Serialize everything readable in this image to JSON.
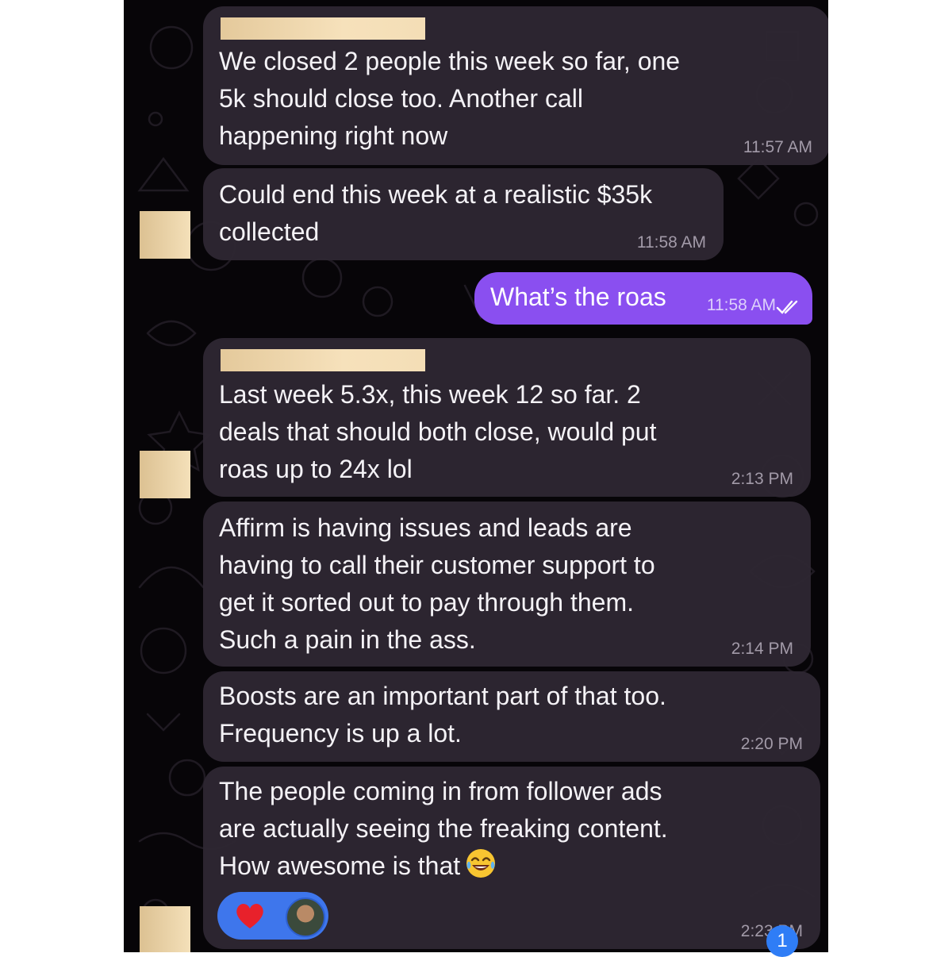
{
  "messages": [
    {
      "direction": "incoming",
      "sender_name": "",
      "text": "We closed 2 people this week so far, one\n5k should close too. Another call\nhappening right now",
      "time": "11:57 AM"
    },
    {
      "direction": "incoming",
      "text": "Could end this week at a realistic $35k\ncollected",
      "time": "11:58 AM"
    },
    {
      "direction": "outgoing",
      "text": "What’s the roas",
      "time": "11:58 AM",
      "status_icon": "double-check-icon"
    },
    {
      "direction": "incoming",
      "sender_name": "",
      "text": "Last week 5.3x, this week 12 so far. 2\ndeals that should both close, would put\nroas up to 24x lol",
      "time": "2:13 PM"
    },
    {
      "direction": "incoming",
      "text": "Affirm is having issues and leads are\nhaving to call their customer support to\nget it sorted out to pay through them.\nSuch a pain in the ass.",
      "time": "2:14 PM"
    },
    {
      "direction": "incoming",
      "text": "Boosts are an important part of that too.\nFrequency is up a lot.",
      "time": "2:20 PM"
    },
    {
      "direction": "incoming",
      "text": "The people coming in from follower ads\nare actually seeing the freaking content.\nHow awesome is that",
      "emoji": "laughing-tears-emoji",
      "time": "2:23 PM",
      "reactions": [
        "red-heart-icon",
        "reactor-avatar"
      ]
    }
  ],
  "unread_count": "1",
  "colors": {
    "chat_background": "#070508",
    "incoming_bubble": "#2e2632",
    "outgoing_bubble": "#8a4ff0",
    "reaction_pill": "#3e76ec",
    "unread_badge": "#2f7df6"
  }
}
